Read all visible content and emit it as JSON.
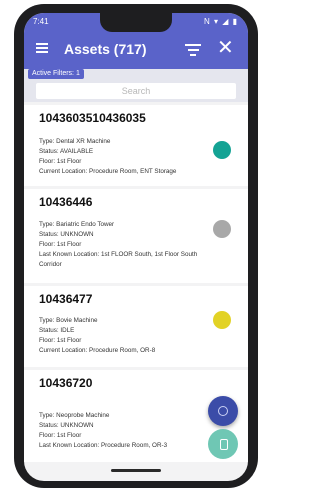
{
  "status_bar": {
    "time": "7:41",
    "left_icons": "M ⊡",
    "right_icons": "N ▾ ◢ ▮"
  },
  "app_bar": {
    "title": "Assets (717)",
    "close_glyph": "✕"
  },
  "filters": {
    "active_label": "Active Filters: 1"
  },
  "search": {
    "placeholder": "Search"
  },
  "assets": [
    {
      "id": "1043603510436035",
      "lines": [
        "Type: Dental XR Machine",
        "Status: AVAILABLE",
        "Floor: 1st Floor",
        "Current Location: Procedure Room, ENT Storage"
      ],
      "status_color": "#14a394"
    },
    {
      "id": "10436446",
      "lines": [
        "Type: Bariatric Endo Tower",
        "Status: UNKNOWN",
        "Floor: 1st Floor",
        "Last Known Location: 1st FLOOR South, 1st Floor South Corridor"
      ],
      "status_color": "#a8a8a8"
    },
    {
      "id": "10436477",
      "lines": [
        "Type: Bovie Machine",
        "Status: IDLE",
        "Floor: 1st Floor",
        "Current Location: Procedure Room, OR-8"
      ],
      "status_color": "#e2d225"
    },
    {
      "id": "10436720",
      "lines": [
        "Type: Neoprobe Machine",
        "Status: UNKNOWN",
        "Floor: 1st Floor",
        "Last Known Location: Procedure Room, OR-3"
      ],
      "status_color": "#a8a8a8"
    }
  ],
  "colors": {
    "primary": "#5a63c9",
    "fab_primary": "#3b4ca8",
    "fab_secondary": "#6fc7b4"
  },
  "icons": {
    "menu": "hamburger-icon",
    "filter": "filter-icon",
    "close": "close-icon",
    "fab1": "scan-icon",
    "fab2": "tag-icon"
  }
}
